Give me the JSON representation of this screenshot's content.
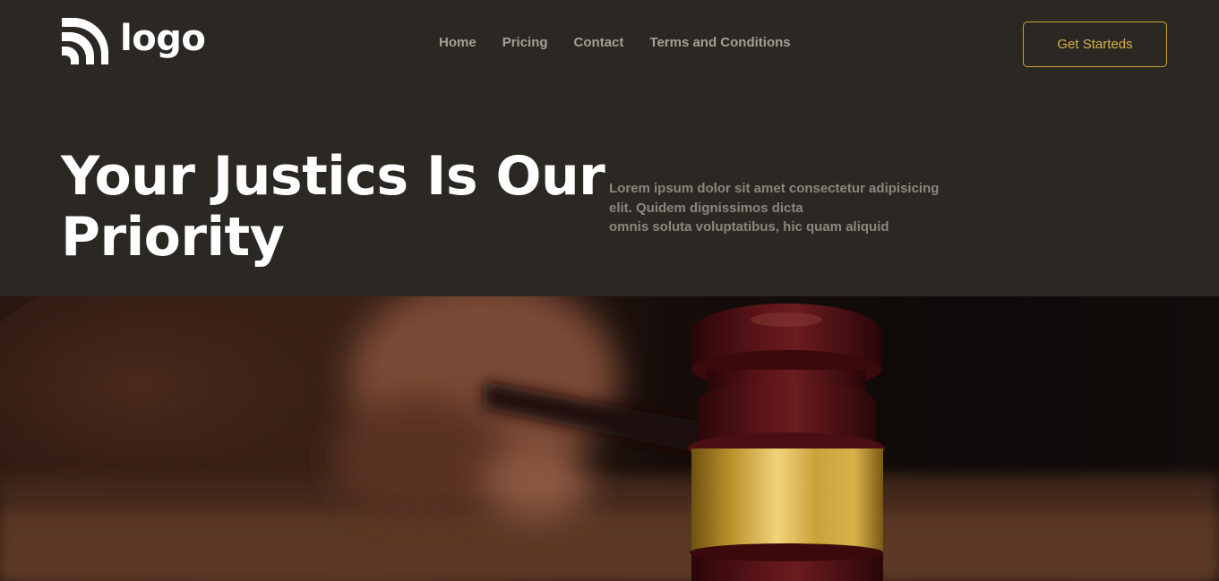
{
  "header": {
    "logo": {
      "text": "logo",
      "icon": "logo-mark-icon"
    },
    "nav": [
      {
        "label": "Home"
      },
      {
        "label": "Pricing"
      },
      {
        "label": "Contact"
      },
      {
        "label": "Terms and Conditions"
      }
    ],
    "cta_label": "Get Starteds"
  },
  "hero": {
    "title_line1": "Your Justics Is Our",
    "title_line2": "Priority",
    "description_lines": [
      "Lorem ipsum dolor sit amet consectetur adipisicing",
      "elit. Quidem dignissimos dicta",
      "omnis soluta voluptatibus, hic quam aliquid"
    ],
    "image": "judge-gavel-photo"
  },
  "colors": {
    "background": "#2b2823",
    "accent": "#c8a233",
    "nav_text": "#a49f96",
    "heading": "#ffffff",
    "body_text": "#8a867f"
  }
}
